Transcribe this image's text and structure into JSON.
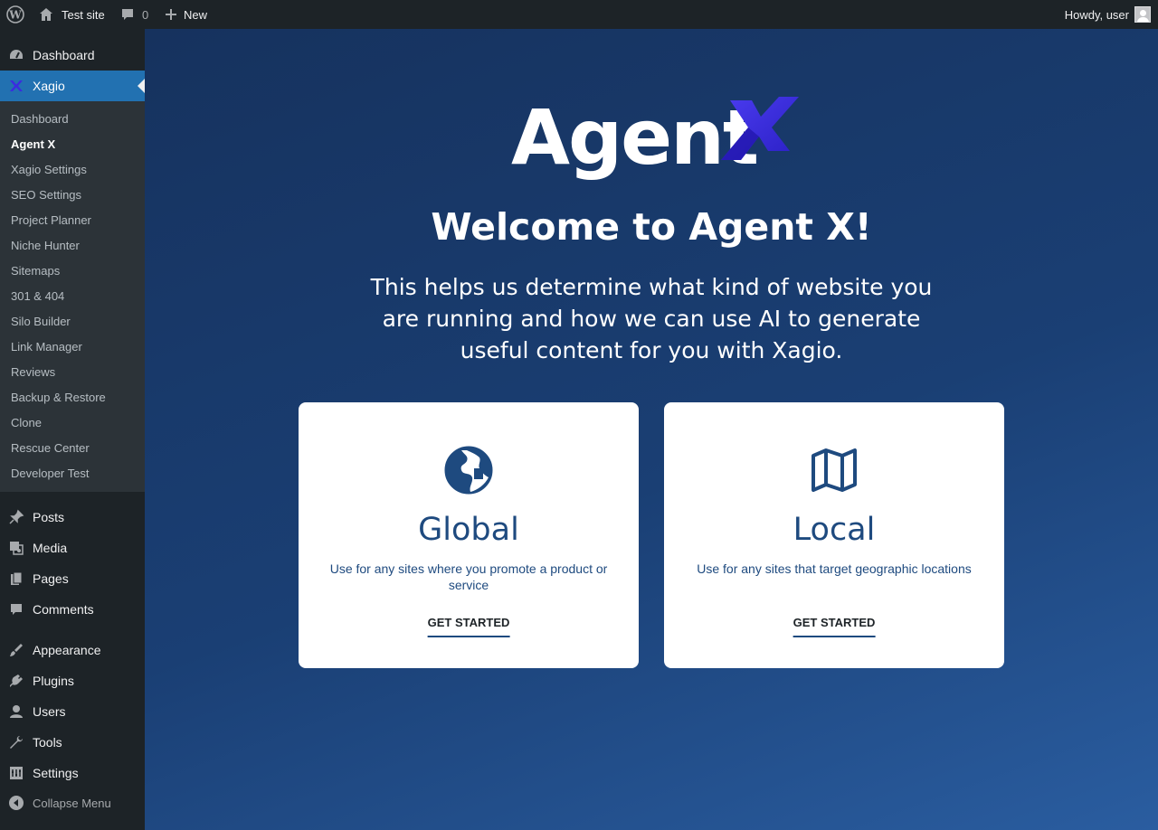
{
  "adminbar": {
    "site_name": "Test site",
    "comment_count": "0",
    "new_label": "New",
    "howdy": "Howdy, user"
  },
  "sidebar": {
    "dashboard": "Dashboard",
    "xagio": "Xagio",
    "submenu": [
      "Dashboard",
      "Agent X",
      "Xagio Settings",
      "SEO Settings",
      "Project Planner",
      "Niche Hunter",
      "Sitemaps",
      "301 & 404",
      "Silo Builder",
      "Link Manager",
      "Reviews",
      "Backup & Restore",
      "Clone",
      "Rescue Center",
      "Developer Test"
    ],
    "posts": "Posts",
    "media": "Media",
    "pages": "Pages",
    "comments": "Comments",
    "appearance": "Appearance",
    "plugins": "Plugins",
    "users": "Users",
    "tools": "Tools",
    "settings": "Settings",
    "collapse": "Collapse Menu"
  },
  "main": {
    "logo_text": "Agent",
    "logo_mark": "X",
    "welcome": "Welcome to Agent X!",
    "description": "This helps us determine what kind of website you are running and how we can use AI to generate useful content for you with Xagio.",
    "cards": [
      {
        "title": "Global",
        "description": "Use for any sites where you promote a product or service",
        "button": "GET STARTED",
        "icon": "globe-icon"
      },
      {
        "title": "Local",
        "description": "Use for any sites that target geographic locations",
        "button": "GET STARTED",
        "icon": "map-icon"
      }
    ]
  },
  "colors": {
    "admin_bg": "#1d2327",
    "active_blue": "#2271b1",
    "submenu_bg": "#2c3338",
    "card_text": "#1e4a7f",
    "logo_x": "#3b2be0"
  }
}
